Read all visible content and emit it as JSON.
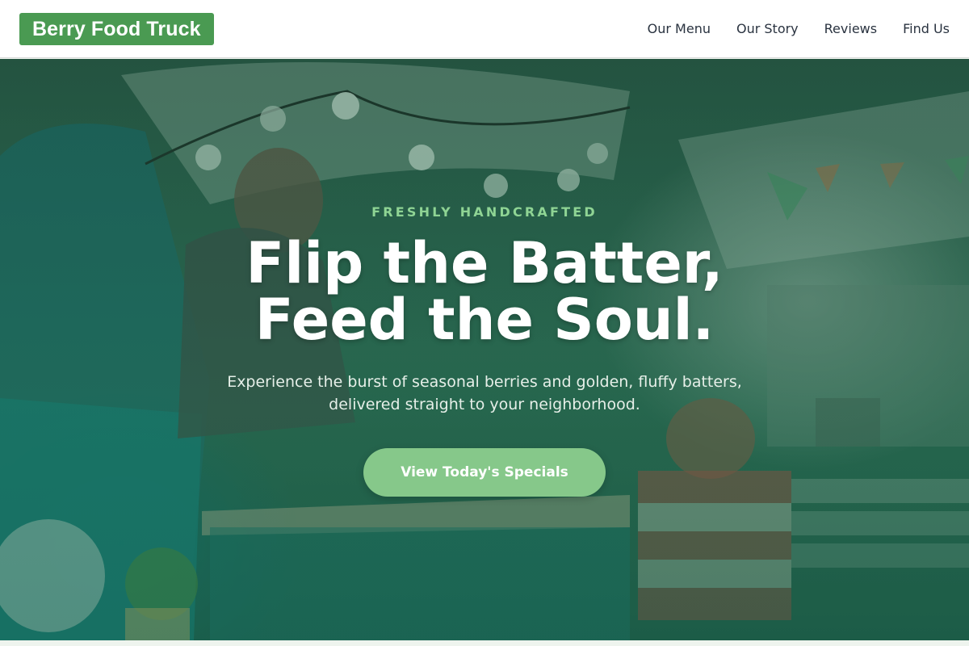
{
  "brand": {
    "logo_text": "Berry Food Truck",
    "accent": "#4a9a52"
  },
  "nav": {
    "links": [
      {
        "label": "Our Menu"
      },
      {
        "label": "Our Story"
      },
      {
        "label": "Reviews"
      },
      {
        "label": "Find Us"
      }
    ]
  },
  "hero": {
    "eyebrow": "FRESHLY HANDCRAFTED",
    "headline_line1": "Flip the Batter,",
    "headline_line2": "Feed the Soul.",
    "subtext_line1": "Experience the burst of seasonal berries and golden, fluffy batters,",
    "subtext_line2": "delivered straight to your neighborhood.",
    "cta_label": "View Today's Specials",
    "background_image": "food-truck-photo"
  },
  "colors": {
    "eyebrow": "#8fd494",
    "cta_background": "#86c88a",
    "overlay": "#2f6a55"
  }
}
